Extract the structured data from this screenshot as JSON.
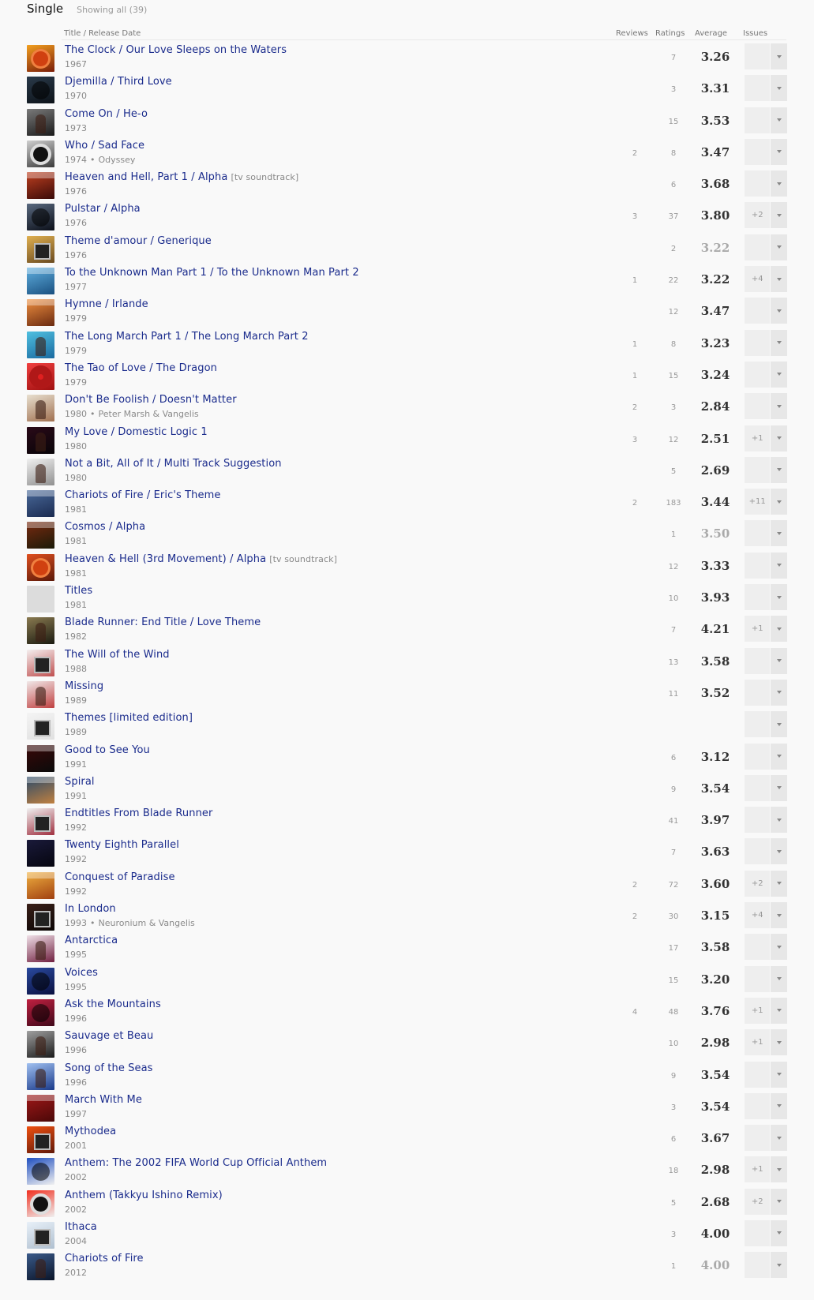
{
  "section": {
    "title": "Single",
    "showing": "Showing all (39)"
  },
  "columns": {
    "title": "Title / Release Date",
    "reviews": "Reviews",
    "ratings": "Ratings",
    "average": "Average",
    "issues": "Issues"
  },
  "rows": [
    {
      "title": "The Clock / Our Love Sleeps on the Waters",
      "tag": "",
      "year": "1967",
      "extra": "",
      "reviews": "",
      "ratings": "7",
      "average": "3.26",
      "dim": false,
      "issues": "",
      "cover": [
        "#f2a020",
        "#7a1c08"
      ],
      "shape": "sun"
    },
    {
      "title": "Djemilla / Third Love",
      "tag": "",
      "year": "1970",
      "extra": "",
      "reviews": "",
      "ratings": "3",
      "average": "3.31",
      "dim": false,
      "issues": "",
      "cover": [
        "#2a3a4a",
        "#0c1218"
      ],
      "shape": "round"
    },
    {
      "title": "Come On / He-o",
      "tag": "",
      "year": "1973",
      "extra": "",
      "reviews": "",
      "ratings": "15",
      "average": "3.53",
      "dim": false,
      "issues": "",
      "cover": [
        "#7a7a7a",
        "#1a1a1a"
      ],
      "shape": "figure"
    },
    {
      "title": "Who / Sad Face",
      "tag": "",
      "year": "1974",
      "extra": "Odyssey",
      "reviews": "2",
      "ratings": "8",
      "average": "3.47",
      "dim": false,
      "issues": "",
      "cover": [
        "#cfcfcf",
        "#3a3a3a"
      ],
      "shape": "ring"
    },
    {
      "title": "Heaven and Hell, Part 1 / Alpha",
      "tag": "[tv soundtrack]",
      "year": "1976",
      "extra": "",
      "reviews": "",
      "ratings": "6",
      "average": "3.68",
      "dim": false,
      "issues": "",
      "cover": [
        "#c04020",
        "#3a0a08"
      ],
      "shape": "bands"
    },
    {
      "title": "Pulstar / Alpha",
      "tag": "",
      "year": "1976",
      "extra": "",
      "reviews": "3",
      "ratings": "37",
      "average": "3.80",
      "dim": false,
      "issues": "+2",
      "cover": [
        "#5a6a80",
        "#0a0e18"
      ],
      "shape": "round"
    },
    {
      "title": "Theme d'amour / Generique",
      "tag": "",
      "year": "1976",
      "extra": "",
      "reviews": "",
      "ratings": "2",
      "average": "3.22",
      "dim": true,
      "issues": "",
      "cover": [
        "#e0b050",
        "#6a4a20"
      ],
      "shape": "frame"
    },
    {
      "title": "To the Unknown Man Part 1 / To the Unknown Man Part 2",
      "tag": "",
      "year": "1977",
      "extra": "",
      "reviews": "1",
      "ratings": "22",
      "average": "3.22",
      "dim": false,
      "issues": "+4",
      "cover": [
        "#60b0e0",
        "#1a5080"
      ],
      "shape": "bands"
    },
    {
      "title": "Hymne / Irlande",
      "tag": "",
      "year": "1979",
      "extra": "",
      "reviews": "",
      "ratings": "12",
      "average": "3.47",
      "dim": false,
      "issues": "",
      "cover": [
        "#f09040",
        "#6a2a10"
      ],
      "shape": "bands"
    },
    {
      "title": "The Long March Part 1 / The Long March Part 2",
      "tag": "",
      "year": "1979",
      "extra": "",
      "reviews": "1",
      "ratings": "8",
      "average": "3.23",
      "dim": false,
      "issues": "",
      "cover": [
        "#50c0e0",
        "#1a6aa0"
      ],
      "shape": "figure"
    },
    {
      "title": "The Tao of Love / The Dragon",
      "tag": "",
      "year": "1979",
      "extra": "",
      "reviews": "1",
      "ratings": "15",
      "average": "3.24",
      "dim": false,
      "issues": "",
      "cover": [
        "#f04040",
        "#a01010"
      ],
      "shape": "disc"
    },
    {
      "title": "Don't Be Foolish / Doesn't Matter",
      "tag": "",
      "year": "1980",
      "extra": "Peter Marsh & Vangelis",
      "reviews": "2",
      "ratings": "3",
      "average": "2.84",
      "dim": false,
      "issues": "",
      "cover": [
        "#e8e0d0",
        "#a07050"
      ],
      "shape": "figure"
    },
    {
      "title": "My Love / Domestic Logic 1",
      "tag": "",
      "year": "1980",
      "extra": "",
      "reviews": "3",
      "ratings": "12",
      "average": "2.51",
      "dim": false,
      "issues": "+1",
      "cover": [
        "#2a0a18",
        "#080408"
      ],
      "shape": "figure"
    },
    {
      "title": "Not a Bit, All of It / Multi Track Suggestion",
      "tag": "",
      "year": "1980",
      "extra": "",
      "reviews": "",
      "ratings": "5",
      "average": "2.69",
      "dim": false,
      "issues": "",
      "cover": [
        "#f0f0f0",
        "#909090"
      ],
      "shape": "figure"
    },
    {
      "title": "Chariots of Fire / Eric's Theme",
      "tag": "",
      "year": "1981",
      "extra": "",
      "reviews": "2",
      "ratings": "183",
      "average": "3.44",
      "dim": false,
      "issues": "+11",
      "cover": [
        "#4a6a9a",
        "#1a2a50"
      ],
      "shape": "bands"
    },
    {
      "title": "Cosmos / Alpha",
      "tag": "",
      "year": "1981",
      "extra": "",
      "reviews": "",
      "ratings": "1",
      "average": "3.50",
      "dim": true,
      "issues": "",
      "cover": [
        "#7a2a10",
        "#1a1a08"
      ],
      "shape": "bands"
    },
    {
      "title": "Heaven & Hell (3rd Movement) / Alpha",
      "tag": "[tv soundtrack]",
      "year": "1981",
      "extra": "",
      "reviews": "",
      "ratings": "12",
      "average": "3.33",
      "dim": false,
      "issues": "",
      "cover": [
        "#e05020",
        "#5a1808"
      ],
      "shape": "sun"
    },
    {
      "title": "Titles",
      "tag": "",
      "year": "1981",
      "extra": "",
      "reviews": "",
      "ratings": "10",
      "average": "3.93",
      "dim": false,
      "issues": "",
      "cover": [
        "#dcdcdc",
        "#dcdcdc"
      ],
      "shape": "none"
    },
    {
      "title": "Blade Runner: End Title / Love Theme",
      "tag": "",
      "year": "1982",
      "extra": "",
      "reviews": "",
      "ratings": "7",
      "average": "4.21",
      "dim": false,
      "issues": "+1",
      "cover": [
        "#8a7a50",
        "#1a1a10"
      ],
      "shape": "figure"
    },
    {
      "title": "The Will of the Wind",
      "tag": "",
      "year": "1988",
      "extra": "",
      "reviews": "",
      "ratings": "13",
      "average": "3.58",
      "dim": false,
      "issues": "",
      "cover": [
        "#f4f0f0",
        "#c05050"
      ],
      "shape": "frame"
    },
    {
      "title": "Missing",
      "tag": "",
      "year": "1989",
      "extra": "",
      "reviews": "",
      "ratings": "11",
      "average": "3.52",
      "dim": false,
      "issues": "",
      "cover": [
        "#f0e8e8",
        "#c04040"
      ],
      "shape": "figure"
    },
    {
      "title": "Themes [limited edition]",
      "tag": "",
      "year": "1989",
      "extra": "",
      "reviews": "",
      "ratings": "",
      "average": "",
      "dim": false,
      "issues": "",
      "cover": [
        "#f4f4f4",
        "#e0e0e0"
      ],
      "shape": "frame"
    },
    {
      "title": "Good to See You",
      "tag": "",
      "year": "1991",
      "extra": "",
      "reviews": "",
      "ratings": "6",
      "average": "3.12",
      "dim": false,
      "issues": "",
      "cover": [
        "#3a0808",
        "#0a0a0a"
      ],
      "shape": "bands"
    },
    {
      "title": "Spiral",
      "tag": "",
      "year": "1991",
      "extra": "",
      "reviews": "",
      "ratings": "9",
      "average": "3.54",
      "dim": false,
      "issues": "",
      "cover": [
        "#2a4a6a",
        "#c08040"
      ],
      "shape": "bands"
    },
    {
      "title": "Endtitles From Blade Runner",
      "tag": "",
      "year": "1992",
      "extra": "",
      "reviews": "",
      "ratings": "41",
      "average": "3.97",
      "dim": false,
      "issues": "",
      "cover": [
        "#f0f0f0",
        "#a03040"
      ],
      "shape": "frame"
    },
    {
      "title": "Twenty Eighth Parallel",
      "tag": "",
      "year": "1992",
      "extra": "",
      "reviews": "",
      "ratings": "7",
      "average": "3.63",
      "dim": false,
      "issues": "",
      "cover": [
        "#1a1a3a",
        "#05050f"
      ],
      "shape": "none"
    },
    {
      "title": "Conquest of Paradise",
      "tag": "",
      "year": "1992",
      "extra": "",
      "reviews": "2",
      "ratings": "72",
      "average": "3.60",
      "dim": false,
      "issues": "+2",
      "cover": [
        "#f0b040",
        "#a04010"
      ],
      "shape": "bands"
    },
    {
      "title": "In London",
      "tag": "",
      "year": "1993",
      "extra": "Neuronium & Vangelis",
      "reviews": "2",
      "ratings": "30",
      "average": "3.15",
      "dim": false,
      "issues": "+4",
      "cover": [
        "#3a2018",
        "#0a0505"
      ],
      "shape": "frame"
    },
    {
      "title": "Antarctica",
      "tag": "",
      "year": "1995",
      "extra": "",
      "reviews": "",
      "ratings": "17",
      "average": "3.58",
      "dim": false,
      "issues": "",
      "cover": [
        "#f0e0e8",
        "#702040"
      ],
      "shape": "figure"
    },
    {
      "title": "Voices",
      "tag": "",
      "year": "1995",
      "extra": "",
      "reviews": "",
      "ratings": "15",
      "average": "3.20",
      "dim": false,
      "issues": "",
      "cover": [
        "#2a4aa0",
        "#0a1040"
      ],
      "shape": "round"
    },
    {
      "title": "Ask the Mountains",
      "tag": "",
      "year": "1996",
      "extra": "",
      "reviews": "4",
      "ratings": "48",
      "average": "3.76",
      "dim": false,
      "issues": "+1",
      "cover": [
        "#c02040",
        "#40081a"
      ],
      "shape": "round"
    },
    {
      "title": "Sauvage et Beau",
      "tag": "",
      "year": "1996",
      "extra": "",
      "reviews": "",
      "ratings": "10",
      "average": "2.98",
      "dim": false,
      "issues": "+1",
      "cover": [
        "#a0a0a0",
        "#1a1a1a"
      ],
      "shape": "figure"
    },
    {
      "title": "Song of the Seas",
      "tag": "",
      "year": "1996",
      "extra": "",
      "reviews": "",
      "ratings": "9",
      "average": "3.54",
      "dim": false,
      "issues": "",
      "cover": [
        "#a0c0f0",
        "#1a3a8a"
      ],
      "shape": "figure"
    },
    {
      "title": "March With Me",
      "tag": "",
      "year": "1997",
      "extra": "",
      "reviews": "",
      "ratings": "3",
      "average": "3.54",
      "dim": false,
      "issues": "",
      "cover": [
        "#a01818",
        "#4a0808"
      ],
      "shape": "bands"
    },
    {
      "title": "Mythodea",
      "tag": "",
      "year": "2001",
      "extra": "",
      "reviews": "",
      "ratings": "6",
      "average": "3.67",
      "dim": false,
      "issues": "",
      "cover": [
        "#f05010",
        "#601808"
      ],
      "shape": "frame"
    },
    {
      "title": "Anthem: The 2002 FIFA World Cup Official Anthem",
      "tag": "",
      "year": "2002",
      "extra": "",
      "reviews": "",
      "ratings": "18",
      "average": "2.98",
      "dim": false,
      "issues": "+1",
      "cover": [
        "#2050c0",
        "#f0f0f0"
      ],
      "shape": "round"
    },
    {
      "title": "Anthem (Takkyu Ishino Remix)",
      "tag": "",
      "year": "2002",
      "extra": "",
      "reviews": "",
      "ratings": "5",
      "average": "2.68",
      "dim": false,
      "issues": "+2",
      "cover": [
        "#f03020",
        "#f0f0f0"
      ],
      "shape": "ring"
    },
    {
      "title": "Ithaca",
      "tag": "",
      "year": "2004",
      "extra": "",
      "reviews": "",
      "ratings": "3",
      "average": "4.00",
      "dim": false,
      "issues": "",
      "cover": [
        "#e8f0f8",
        "#b0c0d0"
      ],
      "shape": "frame"
    },
    {
      "title": "Chariots of Fire",
      "tag": "",
      "year": "2012",
      "extra": "",
      "reviews": "",
      "ratings": "1",
      "average": "4.00",
      "dim": true,
      "issues": "",
      "cover": [
        "#3a5a8a",
        "#0a1428"
      ],
      "shape": "figure"
    }
  ]
}
